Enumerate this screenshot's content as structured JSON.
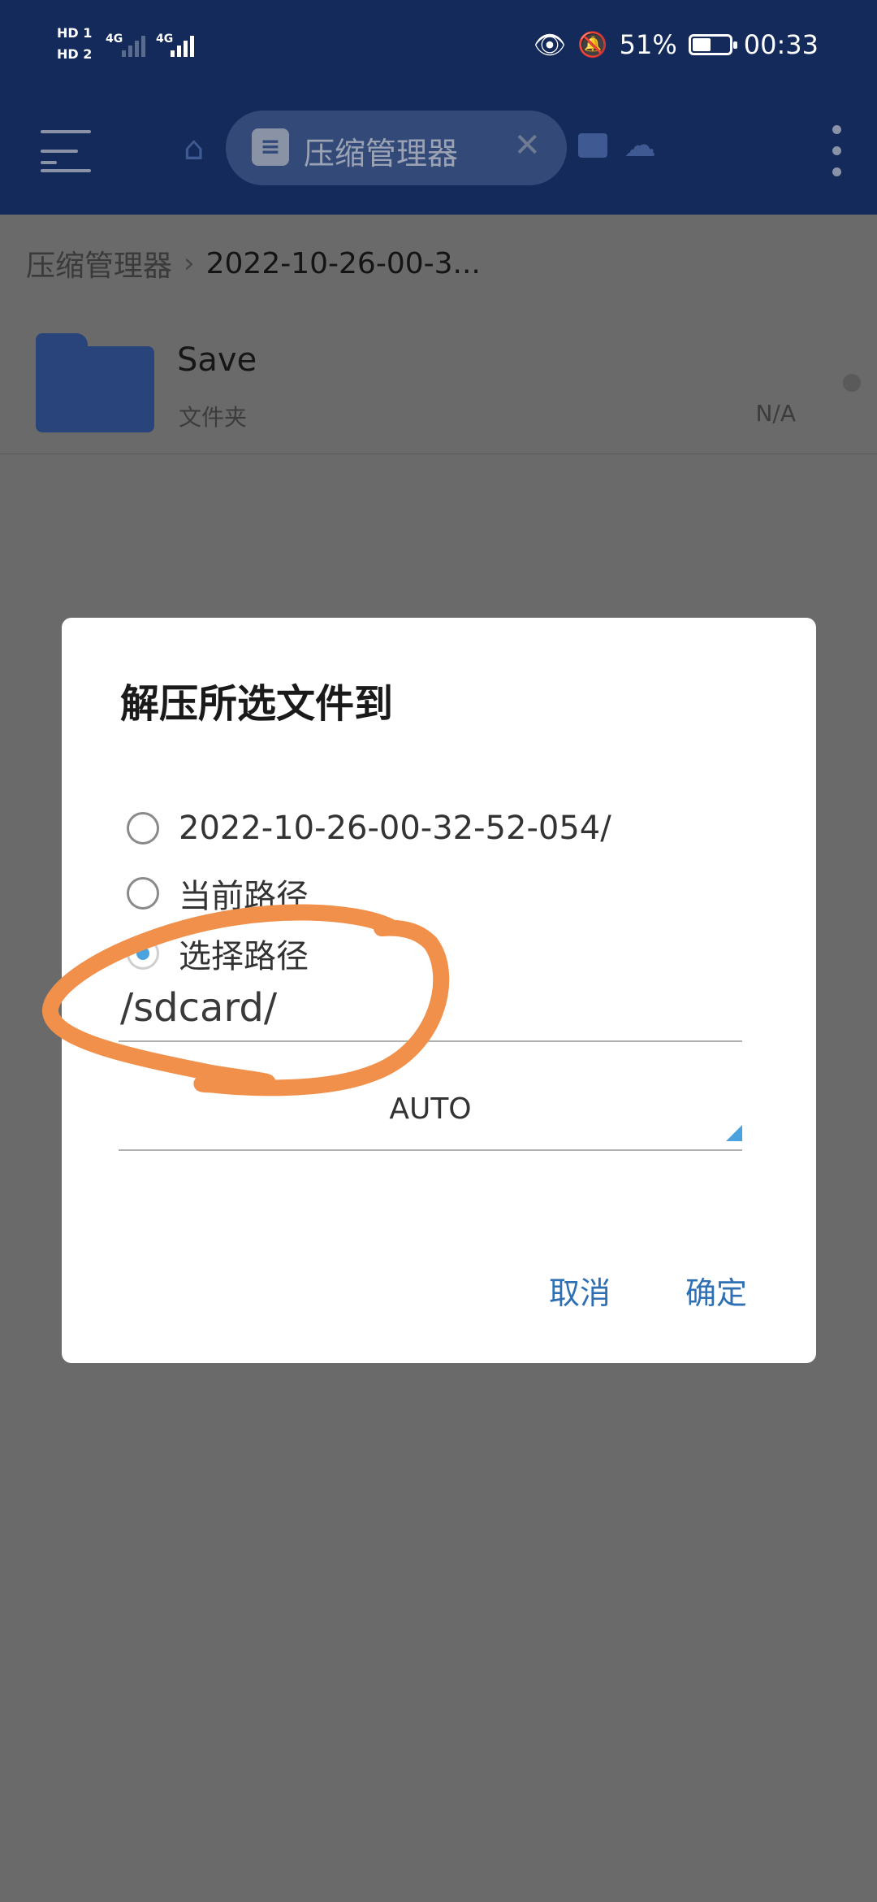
{
  "status_bar": {
    "sim1_label": "HD 1",
    "sim2_label": "HD 2",
    "network_1": "4G",
    "network_2": "4G",
    "battery_percent": "51%",
    "battery_level": 0.51,
    "time": "00:33"
  },
  "toolbar": {
    "active_tab_label": "压缩管理器"
  },
  "breadcrumb": {
    "root": "压缩管理器",
    "current": "2022-10-26-00-3..."
  },
  "file_list": {
    "items": [
      {
        "name": "Save",
        "type": "文件夹",
        "size": "N/A"
      }
    ]
  },
  "dialog": {
    "title": "解压所选文件到",
    "options": [
      {
        "label": "2022-10-26-00-32-52-054/",
        "checked": false
      },
      {
        "label": "当前路径",
        "checked": false
      },
      {
        "label": "选择路径",
        "checked": true
      }
    ],
    "path_value": "/sdcard/",
    "encoding_value": "AUTO",
    "cancel_label": "取消",
    "ok_label": "确定"
  },
  "colors": {
    "header_bg": "#132a5a",
    "accent": "#4aa3df",
    "button_text": "#2f6fb3",
    "annotation": "#f0904a"
  }
}
